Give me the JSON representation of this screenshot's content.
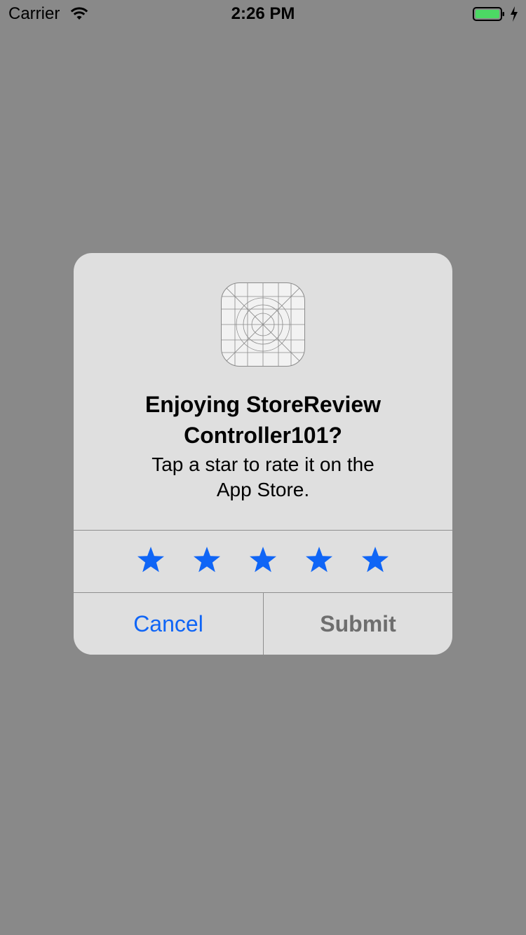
{
  "status_bar": {
    "carrier": "Carrier",
    "time": "2:26 PM",
    "wifi_icon": "wifi-icon",
    "battery_icon": "battery-icon",
    "charging_icon": "charging-bolt-icon",
    "battery_color": "#4cd964"
  },
  "alert": {
    "app_icon": "app-icon-template",
    "title_line1": "Enjoying StoreReview",
    "title_line2": "Controller101?",
    "message_line1": "Tap a star to rate it on the",
    "message_line2": "App Store.",
    "rating": {
      "max": 5,
      "icon": "star-icon",
      "color": "#0f65f6"
    },
    "buttons": {
      "cancel": "Cancel",
      "submit": "Submit"
    }
  },
  "colors": {
    "dimmed_background": "#898989",
    "alert_background": "#dfdfdf",
    "accent": "#0f65f6",
    "disabled_text": "#6e6e6e"
  }
}
